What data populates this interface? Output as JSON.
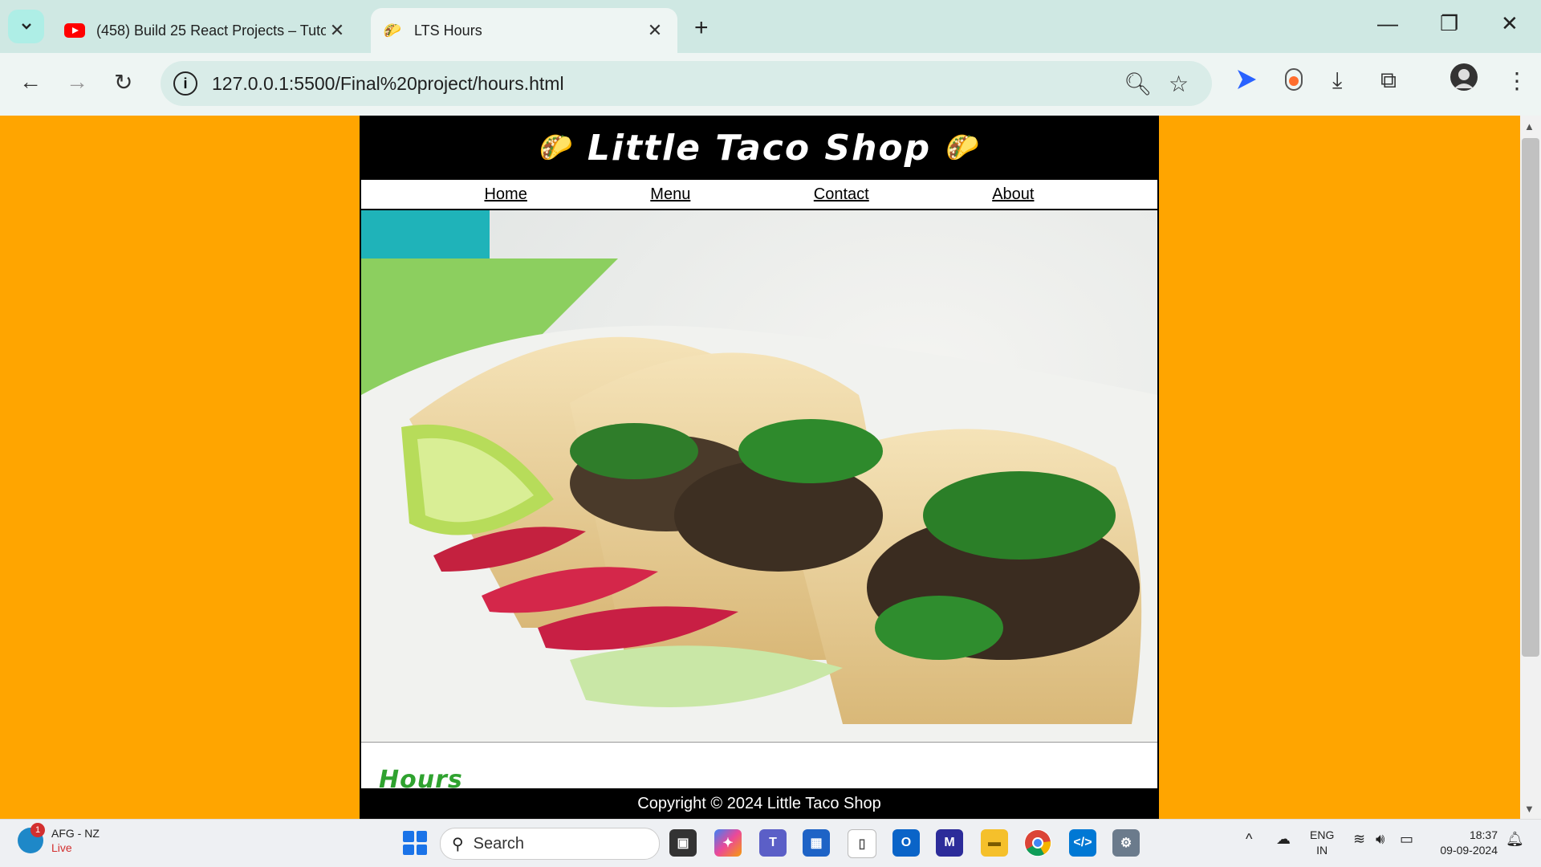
{
  "browser": {
    "tabs": [
      {
        "title": "(458) Build 25 React Projects – Tuto",
        "favicon": "youtube-icon"
      },
      {
        "title": "LTS Hours",
        "favicon": "taco-icon",
        "active": true
      }
    ],
    "url": "127.0.0.1:5500/Final%20project/hours.html"
  },
  "site": {
    "title": "Little Taco Shop",
    "taco_emoji": "🌮",
    "nav": [
      "Home",
      "Menu",
      "Contact",
      "About"
    ],
    "section_heading": "Hours",
    "footer": "Copyright © 2024 Little Taco Shop",
    "hero_alt": "tacos"
  },
  "taskbar": {
    "weather_top": "AFG - NZ",
    "weather_bottom": "Live",
    "weather_badge": "1",
    "search_placeholder": "Search",
    "lang_top": "ENG",
    "lang_bottom": "IN",
    "time": "18:37",
    "date": "09-09-2024"
  },
  "colors": {
    "page_bg": "#ffa500",
    "heading_green": "#2fa22f",
    "header_black": "#000000"
  }
}
